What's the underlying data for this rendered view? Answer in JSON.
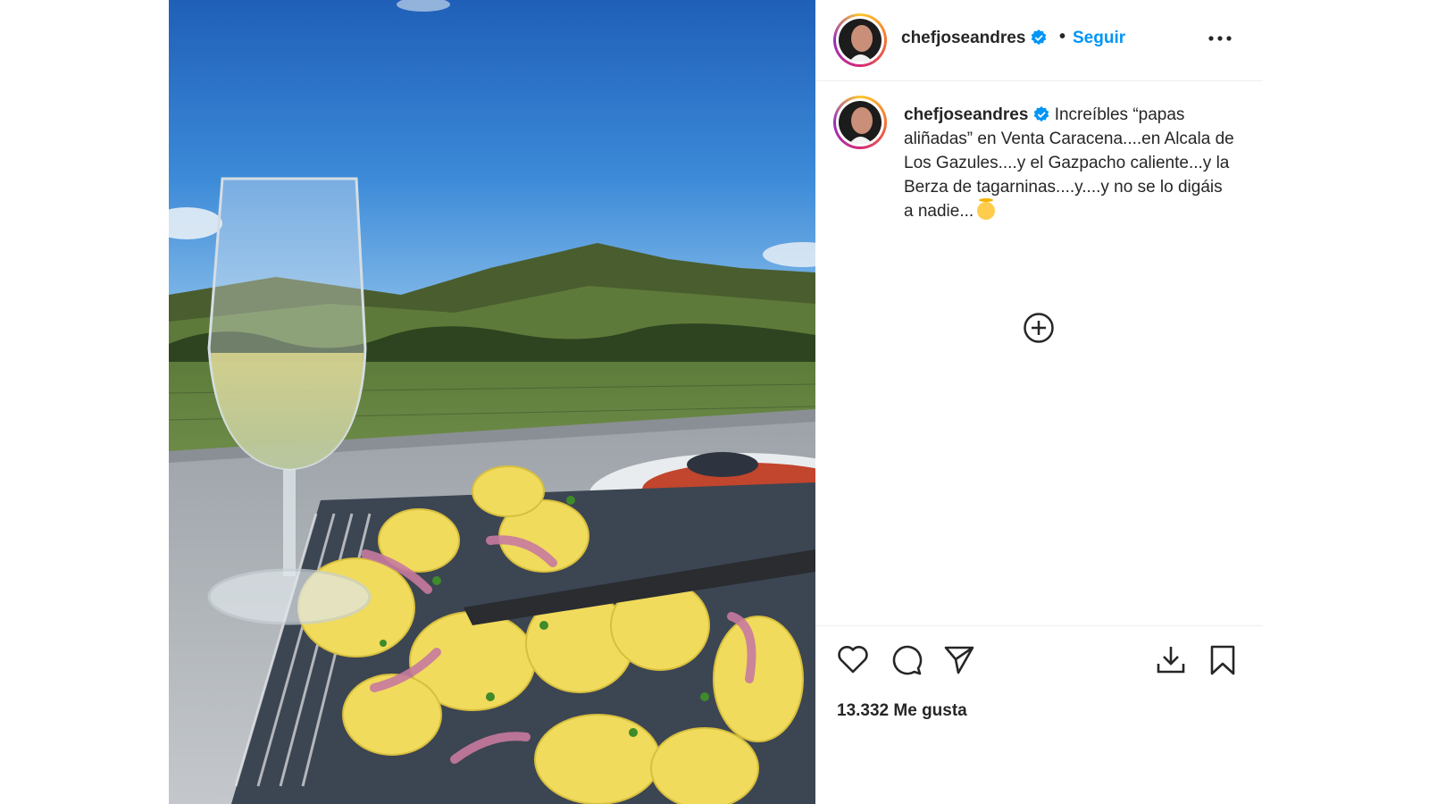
{
  "post": {
    "photo": {
      "icon": "photo-papas-alinadas"
    },
    "header": {
      "username": "chefjoseandres",
      "verified": true,
      "separator": "•",
      "follow_label": "Seguir",
      "more_icon": "more-horizontal-icon"
    },
    "caption": {
      "username": "chefjoseandres",
      "verified": true,
      "text": "Increíbles “papas aliñadas” en Venta Caracena....en Alcala de Los Gazules....y el Gazpacho caliente...y la Berza de tagarninas....y....y no se lo digáis a nadie...",
      "emoji": "smiling-face-with-halo-emoji"
    },
    "add_comment_icon": "plus-circle-icon",
    "actions": {
      "like_icon": "heart-icon",
      "comment_icon": "comment-icon",
      "share_icon": "send-icon",
      "download_icon": "download-icon",
      "save_icon": "bookmark-icon"
    },
    "likes_text": "13.332 Me gusta",
    "colors": {
      "accent": "#0095f6",
      "verified": "#0095f6",
      "text": "#262626",
      "divider": "#efefef"
    }
  }
}
